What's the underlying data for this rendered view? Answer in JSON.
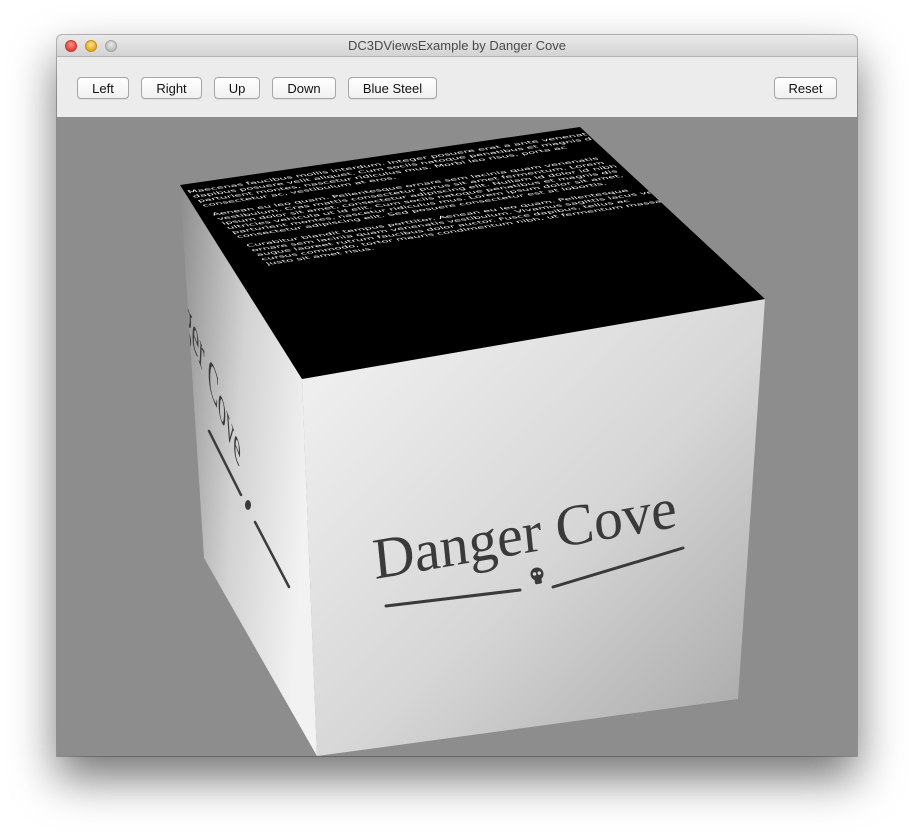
{
  "window": {
    "title": "DC3DViewsExample by Danger Cove"
  },
  "toolbar": {
    "left_label": "Left",
    "right_label": "Right",
    "up_label": "Up",
    "down_label": "Down",
    "blue_steel_label": "Blue Steel",
    "reset_label": "Reset"
  },
  "cube": {
    "front_logo": "Danger Cove",
    "side_logo": "Danger Cove",
    "top_paragraphs": [
      [
        "Maecenas faucibus mollis interdum. Integer posuere erat a ante venenatis",
        "dapibus posuere velit aliquet. Cum sociis natoque penatibus et magnis dis",
        "parturient montes, nascetur ridiculus mus. Morbi leo risus, porta ac",
        "consectetur ac, vestibulum at eros."
      ],
      [
        "Aenean eu leo quam. Pellentesque ornare sem lacinia quam venenatis",
        "vestibulum. Cras mattis consectetur purus sit amet fermentum. Lorem",
        "ipsum dolor sit amet, consectetur adipiscing elit. Nullam id dolor id nibh",
        "ultricies vehicula ut id elit. Cum sociis natoque penatibus et magnis dis",
        "parturient montes, nascetur ridiculus mus. Lorem ipsum dolor sit amet,",
        "consectetur adipiscing elit. Sed posuere consectetur est at lobortis."
      ],
      [
        "Curabitur blandit tempus porttitor. Aenean eu leo quam. Pellentesque",
        "ornare sem lacinia quam venenatis vestibulum. Vivamus sagittis lacus vel",
        "augue laoreet rutrum faucibus dolor auctor. Fusce dapibus, tellus ac",
        "cursus commodo, tortor mauris condimentum nibh, ut fermentum massa",
        "justo sit amet risus."
      ]
    ]
  }
}
